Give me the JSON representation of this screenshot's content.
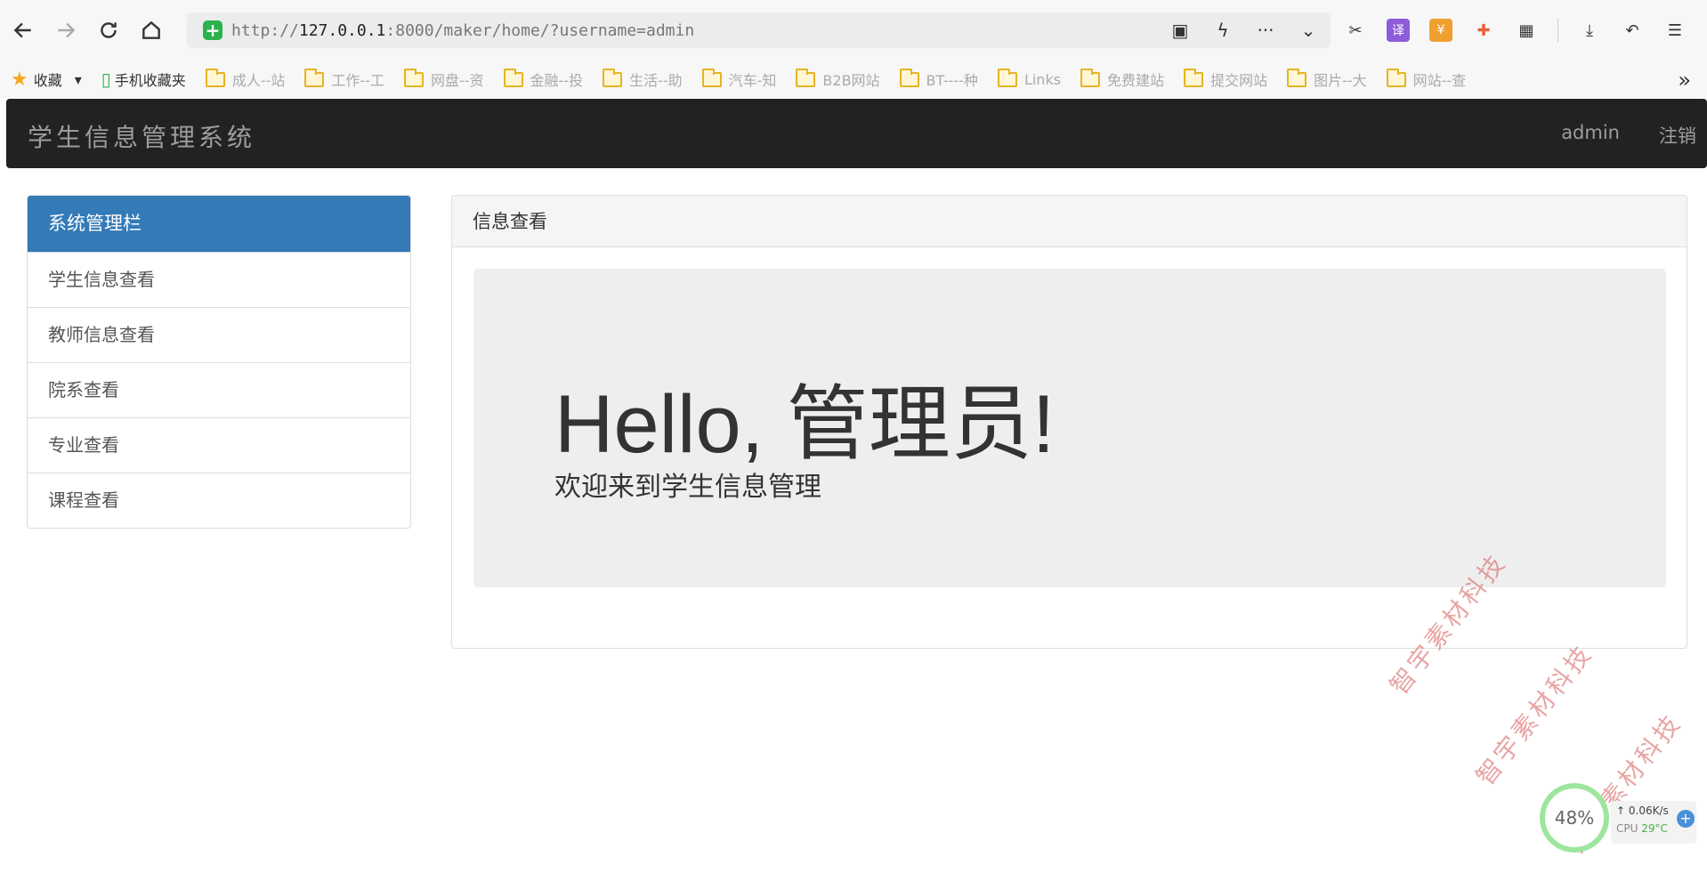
{
  "browser": {
    "url_prefix": "http://",
    "url_host": "127.0.0.1",
    "url_rest": ":8000/maker/home/?username=admin",
    "bookmarks": [
      {
        "label": "收藏",
        "icon": "star-icon"
      },
      {
        "label": "手机收藏夹",
        "icon": "phone-icon"
      },
      {
        "label": "成人--站",
        "icon": "folder-icon"
      },
      {
        "label": "工作--工",
        "icon": "folder-icon"
      },
      {
        "label": "网盘--资",
        "icon": "folder-icon"
      },
      {
        "label": "金融--投",
        "icon": "folder-icon"
      },
      {
        "label": "生活--助",
        "icon": "folder-icon"
      },
      {
        "label": "汽车-知",
        "icon": "folder-icon"
      },
      {
        "label": "B2B网站",
        "icon": "folder-icon"
      },
      {
        "label": "BT----种",
        "icon": "folder-icon"
      },
      {
        "label": "Links",
        "icon": "folder-icon"
      },
      {
        "label": "免费建站",
        "icon": "folder-icon"
      },
      {
        "label": "提交网站",
        "icon": "folder-icon"
      },
      {
        "label": "图片--大",
        "icon": "folder-icon"
      },
      {
        "label": "网站--查",
        "icon": "folder-icon"
      }
    ],
    "more_label": "»"
  },
  "navbar": {
    "brand": "学生信息管理系统",
    "user": "admin",
    "logout": "注销"
  },
  "sidebar": {
    "title": "系统管理栏",
    "items": [
      {
        "label": "学生信息查看"
      },
      {
        "label": "教师信息查看"
      },
      {
        "label": "院系查看"
      },
      {
        "label": "专业查看"
      },
      {
        "label": "课程查看"
      }
    ]
  },
  "main": {
    "panel_title": "信息查看",
    "hero_title": "Hello, 管理员!",
    "hero_subtitle": "欢迎来到学生信息管理"
  },
  "watermark": {
    "text": "智宇素材科技"
  },
  "widget": {
    "percent": "48%",
    "speed": "0.06K/s",
    "cpu_label": "CPU",
    "cpu_temp": "29°C",
    "plus": "+"
  },
  "colors": {
    "navbar_bg": "#222222",
    "sidebar_active": "#337ab7",
    "jumbotron_bg": "#eeeeee"
  }
}
